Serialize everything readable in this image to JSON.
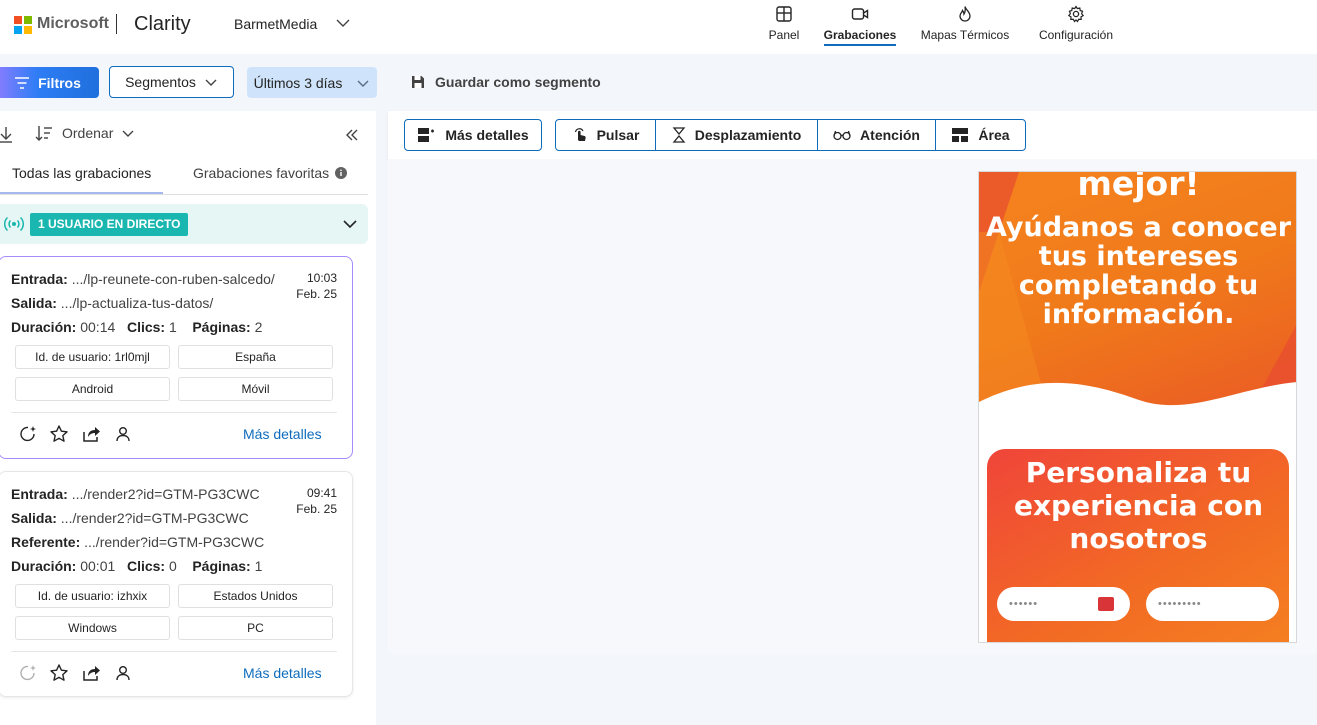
{
  "header": {
    "brand": "Microsoft",
    "product": "Clarity",
    "project": "BarmetMedia",
    "nav": [
      {
        "label": "Panel",
        "icon": "dashboard-icon"
      },
      {
        "label": "Grabaciones",
        "icon": "video-icon",
        "active": true
      },
      {
        "label": "Mapas Térmicos",
        "icon": "flame-icon"
      },
      {
        "label": "Configuración",
        "icon": "gear-icon"
      }
    ]
  },
  "toolbar": {
    "filters_label": "Filtros",
    "segments_label": "Segmentos",
    "date_range": "Últimos 3 días",
    "save_segment_label": "Guardar como segmento"
  },
  "recordings": {
    "order_label": "Ordenar",
    "tab_all": "Todas las grabaciones",
    "tab_favorites": "Grabaciones favoritas",
    "live_badge": "1 USUARIO EN DIRECTO",
    "more_details_label": "Más detalles",
    "items": [
      {
        "entrada_label": "Entrada:",
        "entrada": ".../lp-reunete-con-ruben-salcedo/",
        "salida_label": "Salida:",
        "salida": ".../lp-actualiza-tus-datos/",
        "duracion_label": "Duración:",
        "duracion": "00:14",
        "clics_label": "Clics:",
        "clics": "1",
        "paginas_label": "Páginas:",
        "paginas": "2",
        "time": "10:03",
        "date": "Feb. 25",
        "chips": [
          "Id. de usuario: 1rl0mjl",
          "España",
          "Android",
          "Móvil"
        ]
      },
      {
        "entrada_label": "Entrada:",
        "entrada": ".../render2?id=GTM-PG3CWC",
        "salida_label": "Salida:",
        "salida": ".../render2?id=GTM-PG3CWC",
        "referente_label": "Referente:",
        "referente": ".../render?id=GTM-PG3CWC",
        "duracion_label": "Duración:",
        "duracion": "00:01",
        "clics_label": "Clics:",
        "clics": "0",
        "paginas_label": "Páginas:",
        "paginas": "1",
        "time": "09:41",
        "date": "Feb. 25",
        "chips": [
          "Id. de usuario: izhxix",
          "Estados Unidos",
          "Windows",
          "PC"
        ]
      }
    ]
  },
  "heatmap_toolbar": {
    "details_label": "Más detalles",
    "modes": [
      "Pulsar",
      "Desplazamiento",
      "Atención",
      "Área"
    ]
  },
  "preview": {
    "line_top": "mejor!",
    "hero_lines": [
      "Ayúdanos a conocer",
      "tus intereses",
      "completando tu",
      "información."
    ],
    "card_lines": [
      "Personaliza tu",
      "experiencia con",
      "nosotros"
    ],
    "input1": "••••••",
    "input2": "•••••••••"
  },
  "colors": {
    "accent": "#0f6cbd",
    "live": "#1ab6b0",
    "orange": "#f5821f"
  }
}
